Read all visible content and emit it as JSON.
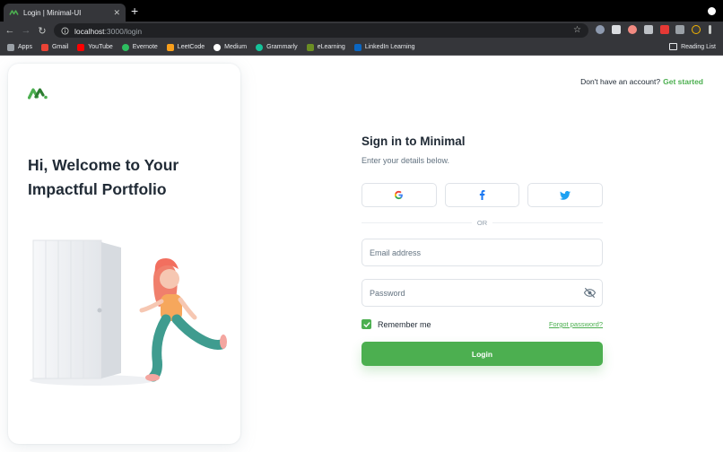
{
  "browser": {
    "tab_title": "Login | Minimal-UI",
    "tab_close": "✕",
    "new_tab": "+",
    "url_host": "localhost",
    "url_path": ":3000/login",
    "bookmarks": [
      {
        "label": "Apps",
        "color": "#9aa0a6"
      },
      {
        "label": "Gmail",
        "color": "#ea4335"
      },
      {
        "label": "YouTube",
        "color": "#ff0000"
      },
      {
        "label": "Evernote",
        "color": "#2dbe60"
      },
      {
        "label": "LeetCode",
        "color": "#f89f1b"
      },
      {
        "label": "Medium",
        "color": "#ffffff"
      },
      {
        "label": "Grammarly",
        "color": "#15c39a"
      },
      {
        "label": "eLearning",
        "color": "#6b8e23"
      },
      {
        "label": "LinkedIn Learning",
        "color": "#0a66c2"
      }
    ],
    "reading_list": "Reading List"
  },
  "hero": {
    "title_line1": "Hi, Welcome to Your",
    "title_line2": "Impactful Portfolio"
  },
  "header": {
    "prompt": "Don't have an account?",
    "get_started": "Get started"
  },
  "form": {
    "title": "Sign in to Minimal",
    "subtitle": "Enter your details below.",
    "or_label": "OR",
    "email_placeholder": "Email address",
    "password_placeholder": "Password",
    "remember_label": "Remember me",
    "remember_checked": true,
    "forgot_label": "Forgot password?",
    "login_label": "Login"
  },
  "colors": {
    "primary": "#4caf50",
    "text": "#212b36",
    "secondary": "#637381"
  }
}
